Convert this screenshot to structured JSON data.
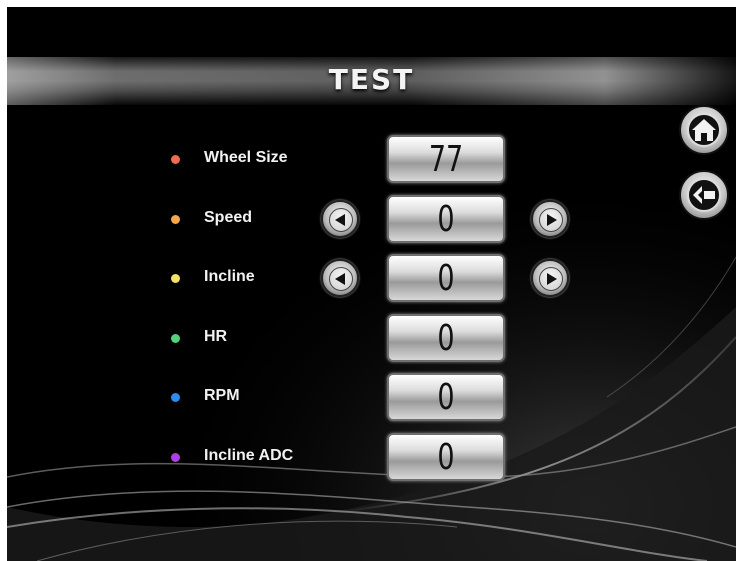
{
  "screen": {
    "title": "TEST"
  },
  "rows": [
    {
      "label": "Wheel Size",
      "value": "77",
      "dot_color": "#f26a4f",
      "has_arrows": false
    },
    {
      "label": "Speed",
      "value": "0",
      "dot_color": "#f6a74a",
      "has_arrows": true
    },
    {
      "label": "Incline",
      "value": "0",
      "dot_color": "#f2e267",
      "has_arrows": true
    },
    {
      "label": "HR",
      "value": "0",
      "dot_color": "#53d17b",
      "has_arrows": false
    },
    {
      "label": "RPM",
      "value": "0",
      "dot_color": "#2b8cf5",
      "has_arrows": false
    },
    {
      "label": "Incline ADC",
      "value": "0",
      "dot_color": "#b03ee6",
      "has_arrows": false
    }
  ],
  "nav": {
    "home_icon": "home-icon",
    "back_icon": "back-arrow-icon"
  }
}
